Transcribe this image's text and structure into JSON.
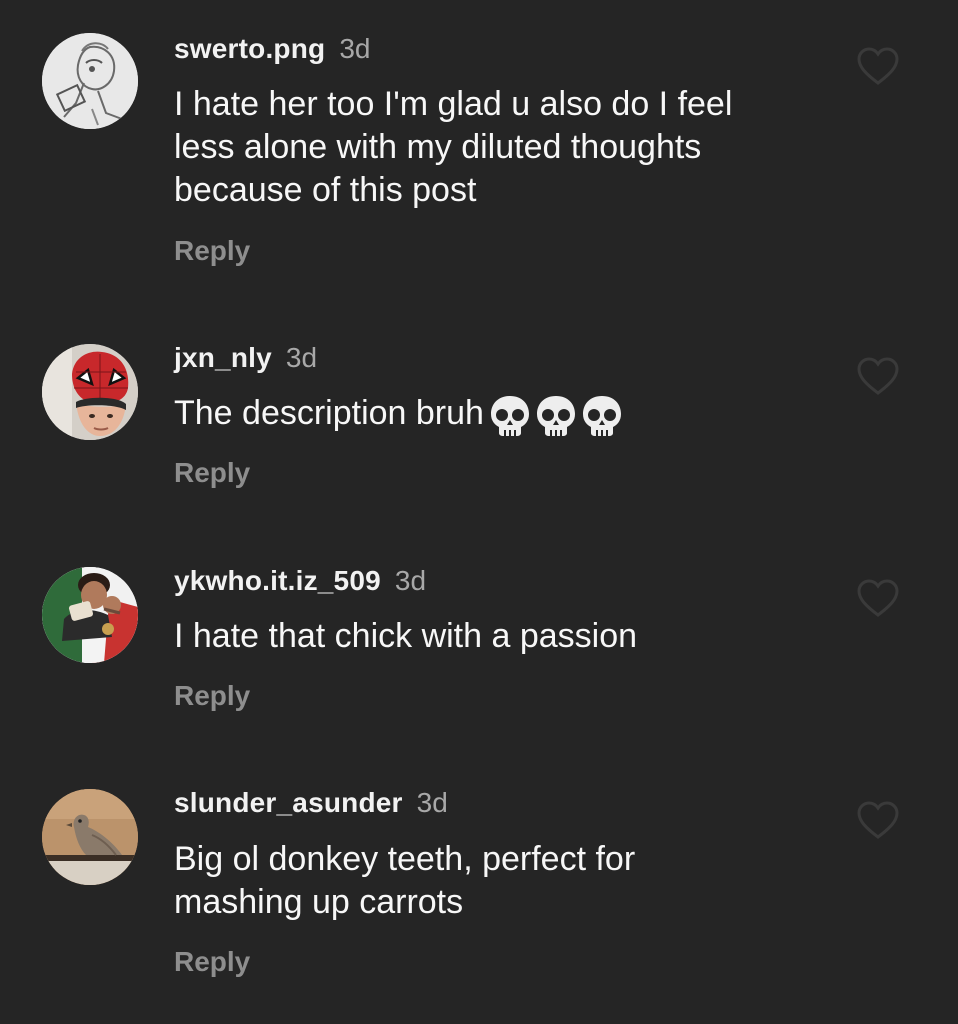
{
  "comments": [
    {
      "username": "swerto.png",
      "time": "3d",
      "text_lines": [
        "I hate her too I'm glad u also do I feel",
        "less alone with my diluted thoughts",
        "because of this post"
      ],
      "reply_label": "Reply",
      "avatar_icon": "cartoon-sketch-avatar",
      "like_icon": "heart-outline-icon"
    },
    {
      "username": "jxn_nly",
      "time": "3d",
      "text": "The description bruh",
      "emoji": "💀💀💀",
      "reply_label": "Reply",
      "avatar_icon": "spiderman-mask-avatar",
      "like_icon": "heart-outline-icon"
    },
    {
      "username": "ykwho.it.iz_509",
      "time": "3d",
      "text": "I hate that chick with a passion",
      "reply_label": "Reply",
      "avatar_icon": "person-with-flag-avatar",
      "like_icon": "heart-outline-icon"
    },
    {
      "username": "slunder_asunder",
      "time": "3d",
      "text_lines": [
        "Big ol donkey teeth, perfect for",
        "mashing up carrots"
      ],
      "reply_label": "Reply",
      "avatar_icon": "pigeon-avatar",
      "like_icon": "heart-outline-icon"
    }
  ],
  "colors": {
    "background": "#252525",
    "username": "#f2f2f2",
    "timestamp": "#a8a8a8",
    "reply": "#8e8e8e",
    "heart": "#3a3a3a"
  }
}
